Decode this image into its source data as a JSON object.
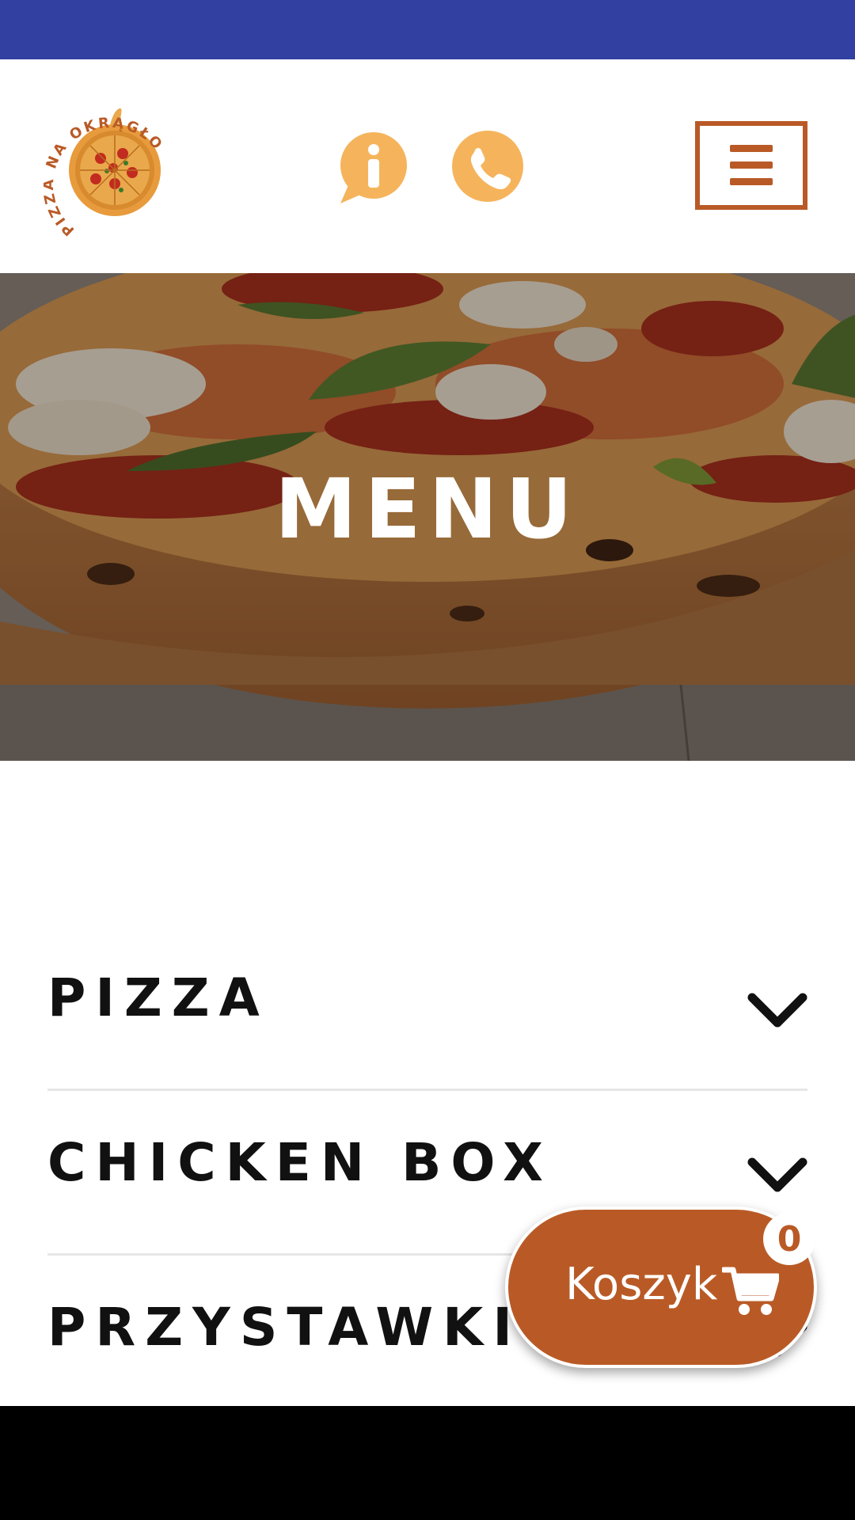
{
  "header": {
    "logo_text": "PIZZA NA OKRĄGŁO",
    "info_icon": "info-icon",
    "phone_icon": "phone-icon",
    "menu_icon": "hamburger-icon"
  },
  "hero": {
    "title": "MENU"
  },
  "categories": [
    {
      "label": "PIZZA"
    },
    {
      "label": "CHICKEN BOX"
    },
    {
      "label": "PRZYSTAWKI"
    }
  ],
  "cart": {
    "label": "Koszyk",
    "count": "0"
  },
  "colors": {
    "status_bar": "#3140a1",
    "accent": "#b95a26",
    "icon_orange": "#f5b45c"
  }
}
